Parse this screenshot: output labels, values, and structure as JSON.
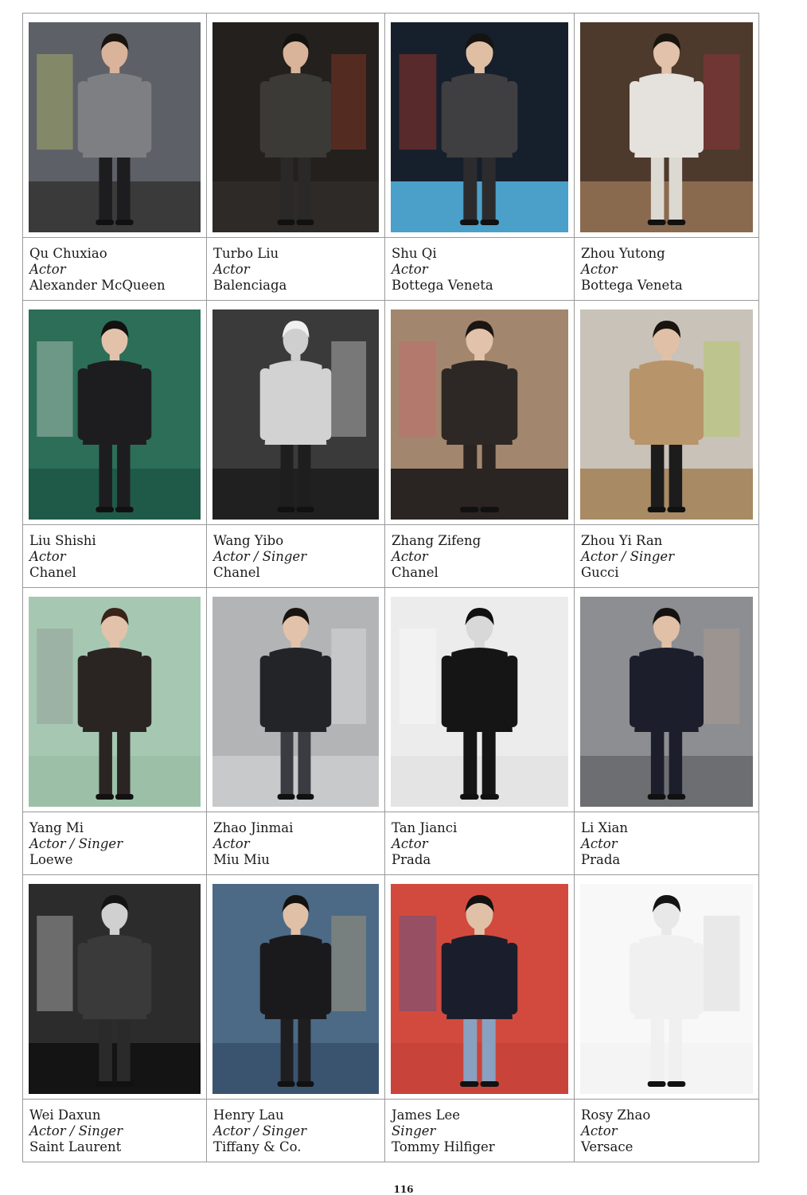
{
  "page_number": "116",
  "people": [
    {
      "name": "Qu Chuxiao",
      "role": "Actor",
      "brand": "Alexander McQueen",
      "photo": {
        "bg": "#5e6068",
        "floor": "#3a3a3a",
        "outfit": "#7d7f83",
        "pants": "#1d1d1f",
        "accent": "#c8d86a",
        "skin": "#d9b49a",
        "hair": "#1a1410",
        "bw": false
      }
    },
    {
      "name": "Turbo Liu",
      "role": "Actor",
      "brand": "Balenciaga",
      "photo": {
        "bg": "#23201d",
        "floor": "#2e2a27",
        "outfit": "#3c3a37",
        "pants": "#2b2927",
        "accent": "#b3412c",
        "skin": "#d9b49a",
        "hair": "#141210",
        "bw": false
      }
    },
    {
      "name": "Shu Qi",
      "role": "Actor",
      "brand": "Bottega Veneta",
      "photo": {
        "bg": "#16202c",
        "floor": "#4aa0c8",
        "outfit": "#3f3f41",
        "pants": "#2c2c2e",
        "accent": "#d6402c",
        "skin": "#e0bea4",
        "hair": "#161310",
        "bw": false
      }
    },
    {
      "name": "Zhou Yutong",
      "role": "Actor",
      "brand": "Bottega Veneta",
      "photo": {
        "bg": "#4d3a2c",
        "floor": "#8a6a4e",
        "outfit": "#e5e1dc",
        "pants": "#dcd8d2",
        "accent": "#b03542",
        "skin": "#e2c2aa",
        "hair": "#1a1410",
        "bw": false
      }
    },
    {
      "name": "Liu Shishi",
      "role": "Actor",
      "brand": "Chanel",
      "photo": {
        "bg": "#2c6e58",
        "floor": "#1f5a48",
        "outfit": "#1d1d1f",
        "pants": "#1d1d1f",
        "accent": "#e8e4de",
        "skin": "#e2c2aa",
        "hair": "#121010",
        "bw": false
      }
    },
    {
      "name": "Wang Yibo",
      "role": "Actor / Singer",
      "brand": "Chanel",
      "photo": {
        "bg": "#3a3a3a",
        "floor": "#202020",
        "outfit": "#d2d2d2",
        "pants": "#1e1e1e",
        "accent": "#efefef",
        "skin": "#cfcfcf",
        "hair": "#f0f0f0",
        "bw": true
      }
    },
    {
      "name": "Zhang Zifeng",
      "role": "Actor",
      "brand": "Chanel",
      "photo": {
        "bg": "#a2866e",
        "floor": "#2a2422",
        "outfit": "#2d2825",
        "pants": "#2a2522",
        "accent": "#d1606a",
        "skin": "#e2c2aa",
        "hair": "#1c1612",
        "bw": false
      }
    },
    {
      "name": "Zhou Yi Ran",
      "role": "Actor / Singer",
      "brand": "Gucci",
      "photo": {
        "bg": "#c8c2b8",
        "floor": "#a88a64",
        "outfit": "#b8946a",
        "pants": "#1c1c1c",
        "accent": "#a8c840",
        "skin": "#e0c0a6",
        "hair": "#1a1410",
        "bw": false
      }
    },
    {
      "name": "Yang Mi",
      "role": "Actor / Singer",
      "brand": "Loewe",
      "photo": {
        "bg": "#a6c8b2",
        "floor": "#9cbfa8",
        "outfit": "#2a2522",
        "pants": "#2a2522",
        "accent": "#8a8a8a",
        "skin": "#e2c2aa",
        "hair": "#3a2418",
        "bw": false
      }
    },
    {
      "name": "Zhao Jinmai",
      "role": "Actor",
      "brand": "Miu Miu",
      "photo": {
        "bg": "#b2b4b6",
        "floor": "#c8c9ca",
        "outfit": "#232428",
        "pants": "#3a3c42",
        "accent": "#eaeaea",
        "skin": "#e2c2aa",
        "hair": "#1a1410",
        "bw": false
      }
    },
    {
      "name": "Tan Jianci",
      "role": "Actor",
      "brand": "Prada",
      "photo": {
        "bg": "#ececec",
        "floor": "#e4e4e4",
        "outfit": "#151515",
        "pants": "#151515",
        "accent": "#ffffff",
        "skin": "#d8d8d8",
        "hair": "#101010",
        "bw": true
      }
    },
    {
      "name": "Li Xian",
      "role": "Actor",
      "brand": "Prada",
      "photo": {
        "bg": "#8c8e92",
        "floor": "#6c6e72",
        "outfit": "#1c1e2c",
        "pants": "#1c1e2c",
        "accent": "#b8a08c",
        "skin": "#e0c0a6",
        "hair": "#141210",
        "bw": false
      }
    },
    {
      "name": "Wei Daxun",
      "role": "Actor / Singer",
      "brand": "Saint Laurent",
      "photo": {
        "bg": "#2c2c2c",
        "floor": "#141414",
        "outfit": "#3a3a3a",
        "pants": "#2a2a2a",
        "accent": "#e4e4e4",
        "skin": "#d0d0d0",
        "hair": "#141414",
        "bw": true
      }
    },
    {
      "name": "Henry Lau",
      "role": "Actor / Singer",
      "brand": "Tiffany & Co.",
      "photo": {
        "bg": "#4c6a86",
        "floor": "#3a5470",
        "outfit": "#1a1a1c",
        "pants": "#1e1e20",
        "accent": "#c8a870",
        "skin": "#e0c0a6",
        "hair": "#141210",
        "bw": false
      }
    },
    {
      "name": "James Lee",
      "role": "Singer",
      "brand": "Tommy Hilfiger",
      "photo": {
        "bg": "#d24a3e",
        "floor": "#c8443a",
        "outfit": "#1a1e2c",
        "pants": "#8aa0c0",
        "accent": "#2a58a8",
        "skin": "#e0c0a6",
        "hair": "#141210",
        "bw": false
      }
    },
    {
      "name": "Rosy Zhao",
      "role": "Actor",
      "brand": "Versace",
      "photo": {
        "bg": "#f8f8f8",
        "floor": "#f4f4f4",
        "outfit": "#f0f0f0",
        "pants": "#f0f0f0",
        "accent": "#cfcfcf",
        "skin": "#e8e8e8",
        "hair": "#141414",
        "bw": true
      }
    }
  ]
}
